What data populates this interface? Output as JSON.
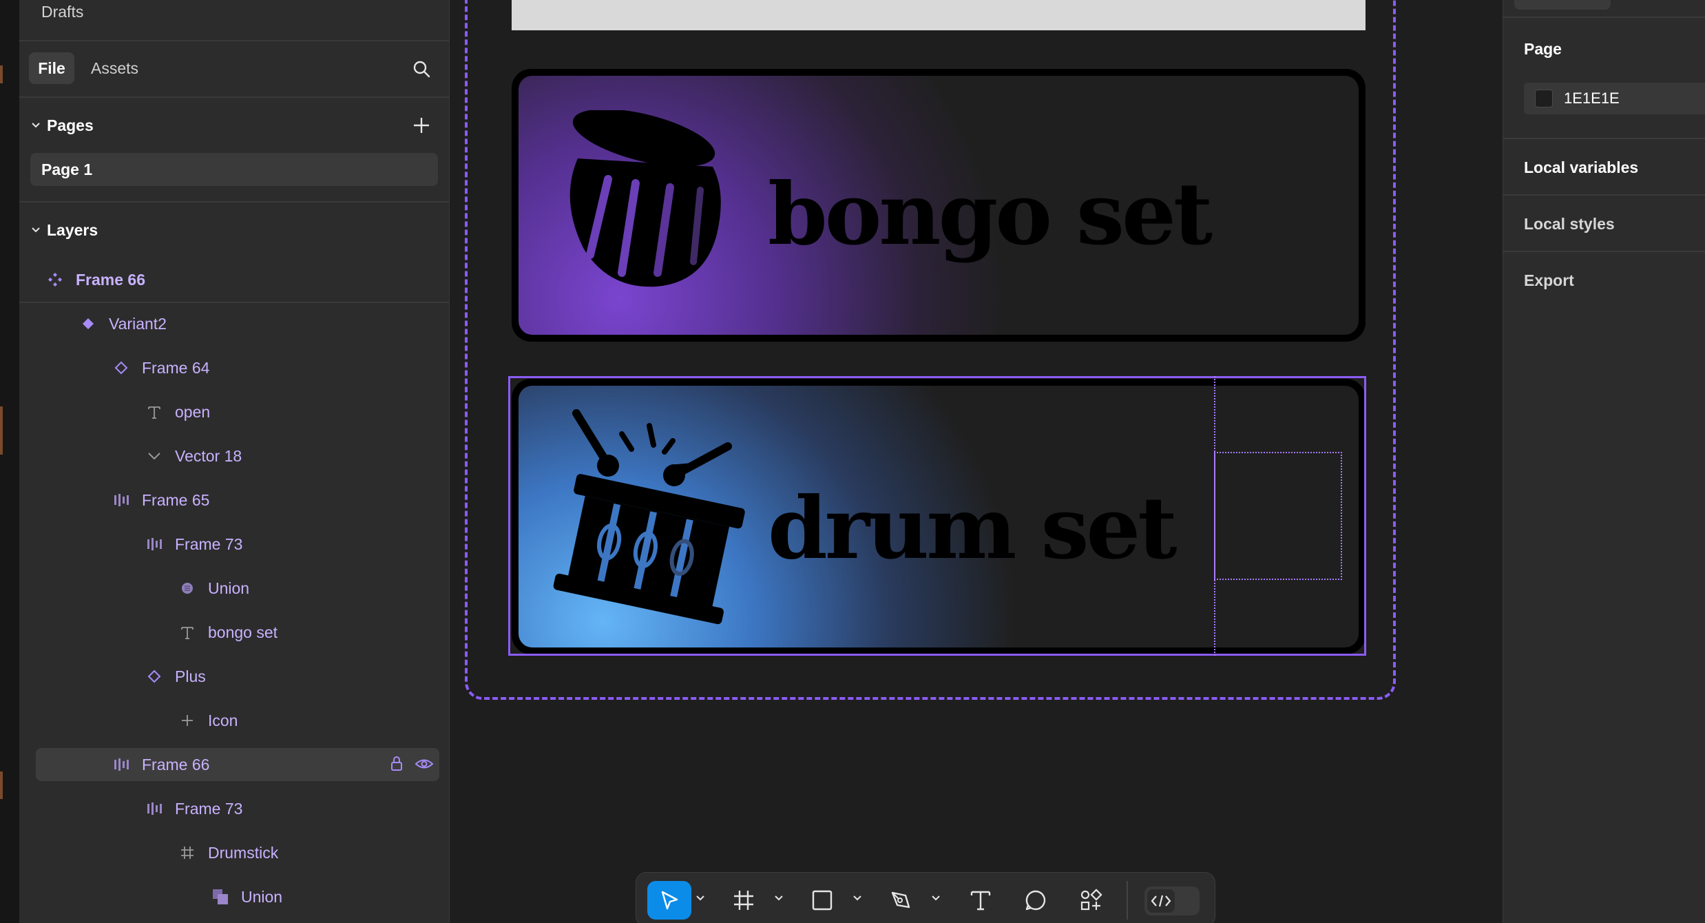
{
  "left_panel": {
    "drafts": "Drafts",
    "tabs": {
      "file": "File",
      "assets": "Assets"
    },
    "pages_header": "Pages",
    "pages": [
      "Page 1"
    ],
    "layers_header": "Layers",
    "layers": [
      {
        "name": "Frame 66",
        "icon": "component-set-icon"
      },
      {
        "name": "Variant2",
        "icon": "component-icon"
      },
      {
        "name": "Frame 64",
        "icon": "instance-icon"
      },
      {
        "name": "open",
        "icon": "text-icon"
      },
      {
        "name": "Vector 18",
        "icon": "vector-icon"
      },
      {
        "name": "Frame 65",
        "icon": "auto-layout-icon"
      },
      {
        "name": "Frame 73",
        "icon": "auto-layout-icon"
      },
      {
        "name": "Union",
        "icon": "boolean-icon"
      },
      {
        "name": "bongo set",
        "icon": "text-icon"
      },
      {
        "name": "Plus",
        "icon": "instance-icon"
      },
      {
        "name": "Icon",
        "icon": "plus-icon"
      },
      {
        "name": "Frame 66",
        "icon": "auto-layout-icon"
      },
      {
        "name": "Frame 73",
        "icon": "auto-layout-icon"
      },
      {
        "name": "Drumstick",
        "icon": "frame-icon"
      },
      {
        "name": "Union",
        "icon": "union-icon"
      }
    ]
  },
  "canvas": {
    "cards": [
      {
        "label": "bongo set",
        "icon": "bongo-icon"
      },
      {
        "label": "drum set",
        "icon": "drum-icon"
      }
    ]
  },
  "right_panel": {
    "page_title": "Page",
    "page_color": "1E1E1E",
    "sections": [
      "Local variables",
      "Local styles",
      "Export"
    ]
  },
  "toolbar": {
    "tools": [
      "move-tool",
      "frame-tool",
      "rectangle-tool",
      "pen-tool",
      "text-tool",
      "comment-tool",
      "actions-tool",
      "dev-mode-toggle"
    ]
  },
  "colors": {
    "accent": "#8b5cf6",
    "toolbar_active": "#0c8ce9",
    "canvas_bg": "#1e1e1e",
    "panel_bg": "#2c2c2c",
    "bongo_gradient": "#7a45cf",
    "drum_gradient": "#64b5f6"
  }
}
